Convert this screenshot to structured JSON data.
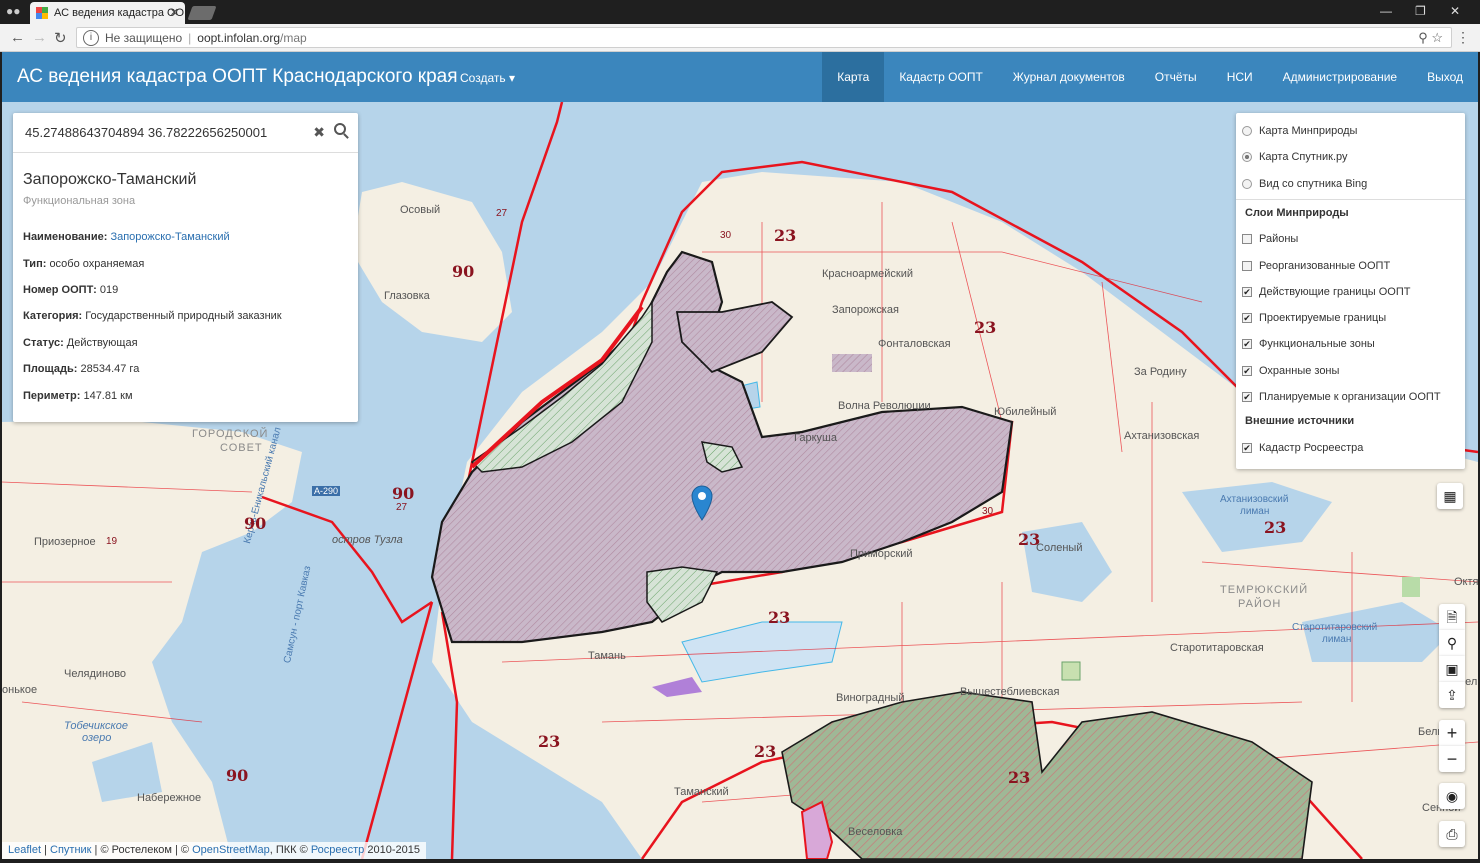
{
  "browser": {
    "tab_title": "АС ведения кадастра ОО",
    "address_security": "Не защищено",
    "address_host": "oopt.infolan.org",
    "address_path": "/map"
  },
  "header": {
    "brand": "АС ведения кадастра ООПТ Краснодарского края",
    "create_label": "Создать",
    "menu": [
      {
        "label": "Карта",
        "active": true
      },
      {
        "label": "Кадастр ООПТ"
      },
      {
        "label": "Журнал документов"
      },
      {
        "label": "Отчёты"
      },
      {
        "label": "НСИ"
      },
      {
        "label": "Администрирование"
      },
      {
        "label": "Выход"
      }
    ]
  },
  "info": {
    "search_value": "45.27488643704894 36.78222656250001",
    "title": "Запорожско-Таманский",
    "subtitle": "Функциональная зона",
    "fields": [
      {
        "label": "Наименование:",
        "value": "Запорожско-Таманский",
        "link": true
      },
      {
        "label": "Тип:",
        "value": "особо охраняемая"
      },
      {
        "label": "Номер ООПТ:",
        "value": "019"
      },
      {
        "label": "Категория:",
        "value": "Государственный природный заказник"
      },
      {
        "label": "Статус:",
        "value": "Действующая"
      },
      {
        "label": "Площадь:",
        "value": "28534.47 га"
      },
      {
        "label": "Периметр:",
        "value": "147.81 км"
      }
    ]
  },
  "layers": {
    "base": [
      {
        "label": "Карта Минприроды",
        "selected": false
      },
      {
        "label": "Карта Спутник.ру",
        "selected": true
      },
      {
        "label": "Вид со спутника Bing",
        "selected": false
      }
    ],
    "group1_title": "Слои Минприроды",
    "group1": [
      {
        "label": "Районы",
        "checked": false
      },
      {
        "label": "Реорганизованные ООПТ",
        "checked": false
      },
      {
        "label": "Действующие границы ООПТ",
        "checked": true
      },
      {
        "label": "Проектируемые границы",
        "checked": true
      },
      {
        "label": "Функциональные зоны",
        "checked": true
      },
      {
        "label": "Охранные зоны",
        "checked": true
      },
      {
        "label": "Планируемые к организации ООПТ",
        "checked": true
      }
    ],
    "group2_title": "Внешние источники",
    "group2": [
      {
        "label": "Кадастр Росреестра",
        "checked": true
      }
    ]
  },
  "map_labels": {
    "osovy": "Осовый",
    "glazovka": "Глазовка",
    "gorodskoy": "ГОРОДСКОЙ",
    "sovet": "СОВЕТ",
    "priozernoe": "Приозерное",
    "ostrov_tuzla": "остров Тузла",
    "chelyadinovo": "Челядиново",
    "onkovo": "онькое",
    "tobechikskoe": "Тобечикское",
    "ozero": "озеро",
    "naberezhnoe": "Набережное",
    "krasnoarmeysky": "Красноармейский",
    "zaporozhskaya": "Запорожская",
    "fontalovskaya": "Фонталовская",
    "volna_revolyutsii": "Волна Революции",
    "yubileyny": "Юбилейный",
    "za_rodinu": "За Родину",
    "akhtanizovskaya": "Ахтанизовская",
    "akhtanizovsky_liman": "Ахтанизовский",
    "liman": "лиман",
    "solenyy": "Соленый",
    "primorsky": "Приморский",
    "veselovka_station": "Гаркуша",
    "taman": "Тамань",
    "vinogradny": "Виноградный",
    "vyshesteblievskaya": "Вышестеблиевская",
    "tamansky": "Таманский",
    "veselovka": "Веселовка",
    "temryuksky": "ТЕМРЮКСКИЙ",
    "rayon": "РАЙОН",
    "starotitarovskaya": "Старотитаровская",
    "starotitarovsky_liman": "Старотитаровский",
    "liman2": "лиман",
    "oktyabrsky": "Октя",
    "strelka": "Стрел",
    "bely": "Белый",
    "sennoy": "Сенной",
    "kerch_strait": "Керчь-Еникальский канал",
    "ferry_route": "Самсун - порт Кавказ",
    "a290": "А-290"
  },
  "zone_numbers": [
    "23",
    "27",
    "90",
    "30",
    "19"
  ],
  "attribution": {
    "leaflet": "Leaflet",
    "sputnik": "Спутник",
    "rostelecom": "© Ростелеком",
    "osm_prefix": "©",
    "osm": "OpenStreetMap",
    "pkk": ", ПКК ©",
    "rosreestr": "Росреестр",
    "years": "2010-2015"
  },
  "controls": {
    "zoom_in": "+",
    "zoom_out": "−"
  },
  "colors": {
    "navbar": "#3b86bd",
    "navbar_active": "#2c6f9f",
    "sea": "#b6d4ea",
    "land": "#f4efe3",
    "boundary_red": "#e8141e",
    "zone_fill": "#c8b6c8"
  }
}
